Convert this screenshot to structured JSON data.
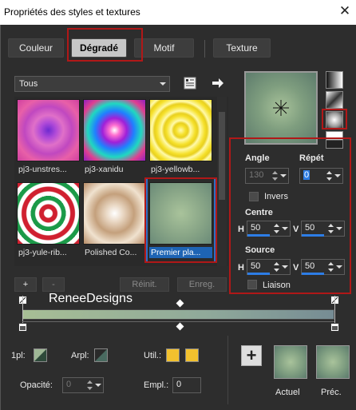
{
  "window": {
    "title": "Propriétés des styles et textures",
    "close": "✕"
  },
  "tabs": [
    {
      "label": "Couleur"
    },
    {
      "label": "Dégradé"
    },
    {
      "label": "Motif"
    },
    {
      "label": "Texture"
    }
  ],
  "filter": {
    "selected": "Tous"
  },
  "presets": [
    {
      "label": "pj3-unstres..."
    },
    {
      "label": "pj3-xanidu"
    },
    {
      "label": "pj3-yellowb..."
    },
    {
      "label": "pj3-yule-rib..."
    },
    {
      "label": "Polished Co..."
    },
    {
      "label": "Premier pla..."
    }
  ],
  "preset_buttons": {
    "add": "+",
    "remove": "-",
    "reset": "Réinit.",
    "save": "Enreg."
  },
  "params": {
    "angle_label": "Angle",
    "angle_value": "130",
    "repeat_label": "Répét",
    "repeat_value": "0",
    "invert_label": "Invers",
    "center_label": "Centre",
    "center_h_label": "H",
    "center_h": "50",
    "center_v_label": "V",
    "center_v": "50",
    "source_label": "Source",
    "source_h_label": "H",
    "source_h": "50",
    "source_v_label": "V",
    "source_v": "50",
    "link_label": "Liaison"
  },
  "watermark": "ReneeDesigns",
  "stops": {
    "stop_label_1": "1pl:",
    "stop_label_2": "Arpl:",
    "util_label": "Util.:",
    "util_color": "#f2c12e",
    "opacity_label": "Opacité:",
    "opacity_value": "0",
    "location_label": "Empl.:",
    "location_value": "0"
  },
  "results": {
    "add": "+",
    "current": "Actuel",
    "previous": "Préc."
  },
  "colors": {
    "accent": "#2f6fc4",
    "highlight": "#b01818"
  }
}
